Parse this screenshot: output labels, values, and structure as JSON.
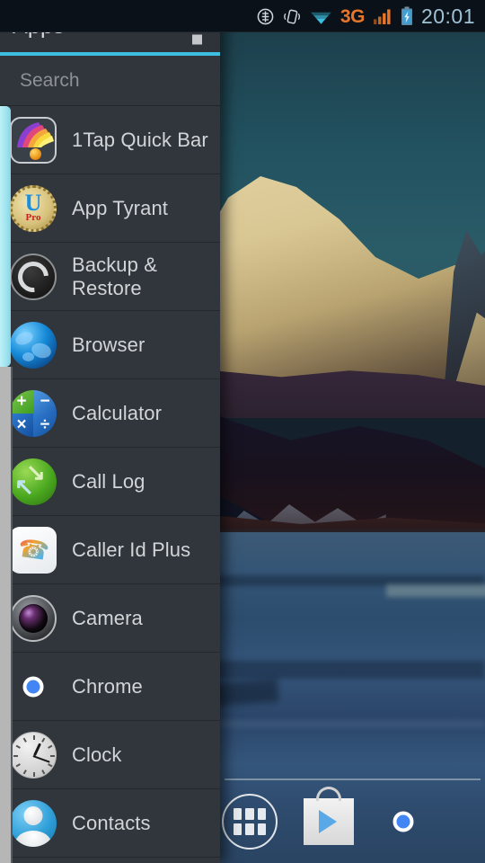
{
  "statusbar": {
    "icons": [
      "bluetooth-tether-icon",
      "vibrate-icon",
      "wifi-icon",
      "signal-bars-icon",
      "battery-charging-icon"
    ],
    "network_label": "3G",
    "clock": "20:01",
    "clock_color": "#9fc2d4",
    "network_color": "#e8762a",
    "background": "#0a1118"
  },
  "drawer": {
    "title": "Apps",
    "overflow_label": "More options",
    "accent_color": "#3cbfe0",
    "background": "#31363c",
    "search": {
      "placeholder": "Search",
      "value": ""
    },
    "apps": [
      {
        "label": "1Tap Quick Bar",
        "icon": "1tap-quick-bar-icon"
      },
      {
        "label": "App Tyrant",
        "icon": "app-tyrant-icon"
      },
      {
        "label": "Backup & Restore",
        "icon": "backup-restore-icon"
      },
      {
        "label": "Browser",
        "icon": "browser-icon"
      },
      {
        "label": "Calculator",
        "icon": "calculator-icon"
      },
      {
        "label": "Call Log",
        "icon": "call-log-icon"
      },
      {
        "label": "Caller Id Plus",
        "icon": "caller-id-plus-icon"
      },
      {
        "label": "Camera",
        "icon": "camera-icon"
      },
      {
        "label": "Chrome",
        "icon": "chrome-icon"
      },
      {
        "label": "Clock",
        "icon": "clock-icon"
      },
      {
        "label": "Contacts",
        "icon": "contacts-icon"
      }
    ]
  },
  "dock": {
    "items": [
      {
        "label": "Apps",
        "icon": "all-apps-icon"
      },
      {
        "label": "Play Store",
        "icon": "play-store-icon"
      },
      {
        "label": "Chrome",
        "icon": "chrome-icon"
      }
    ]
  },
  "wallpaper": {
    "description": "Mountain at sunset above a frozen lake",
    "sky_color": "#2a5c68",
    "peak_color": "#d9c793",
    "lake_color": "#35557a"
  },
  "calculator_symbols": {
    "plus": "+",
    "minus": "−",
    "times": "×",
    "divide": "÷"
  },
  "call_log_arrows": {
    "out": "↘",
    "in": "↖"
  },
  "caller_id_glyph": "☎",
  "app_tyrant_badge": {
    "letter": "U",
    "sub": "Pro"
  }
}
